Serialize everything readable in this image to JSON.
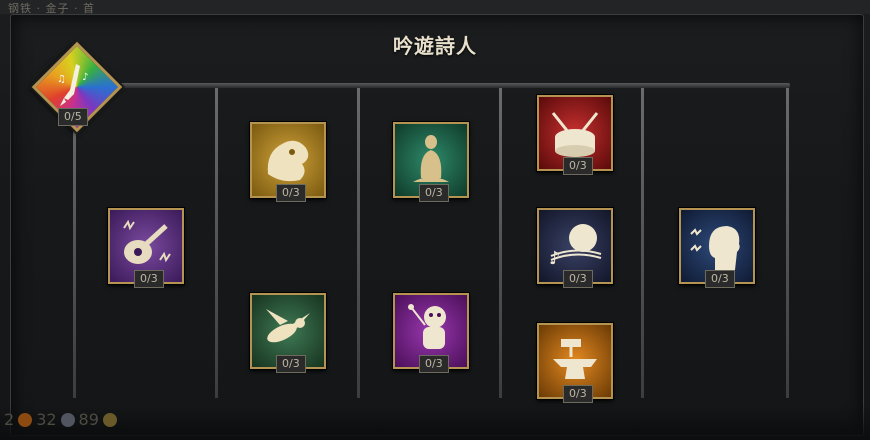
{
  "topbar": {
    "text": "钢铁 · 金子 · 首"
  },
  "tree": {
    "title": "吟遊詩人"
  },
  "badge": {
    "points": "0/5",
    "icon": "bard-rainbow-icon"
  },
  "skills": [
    {
      "name": "lute-skill",
      "icon": "lute-icon",
      "points": "0/3",
      "color": "#5a2d7a"
    },
    {
      "name": "golden-beast-skill",
      "icon": "beast-icon",
      "points": "0/3",
      "color": "#b8891f"
    },
    {
      "name": "hornet-skill",
      "icon": "hornet-icon",
      "points": "0/3",
      "color": "#2e5a3c"
    },
    {
      "name": "meditation-skill",
      "icon": "meditation-icon",
      "points": "0/3",
      "color": "#1e6650"
    },
    {
      "name": "voodoo-doll-skill",
      "icon": "voodoo-doll-icon",
      "points": "0/3",
      "color": "#7a1f8a"
    },
    {
      "name": "war-drum-skill",
      "icon": "drum-icon",
      "points": "0/3",
      "color": "#9b1a1a"
    },
    {
      "name": "night-song-skill",
      "icon": "music-notes-icon",
      "points": "0/3",
      "color": "#222a44"
    },
    {
      "name": "anvil-skill",
      "icon": "anvil-icon",
      "points": "0/3",
      "color": "#c26a10"
    },
    {
      "name": "shout-skill",
      "icon": "shout-icon",
      "points": "0/3",
      "color": "#1d3358"
    }
  ],
  "currency": {
    "a": "2",
    "b": "32",
    "c": "89"
  }
}
